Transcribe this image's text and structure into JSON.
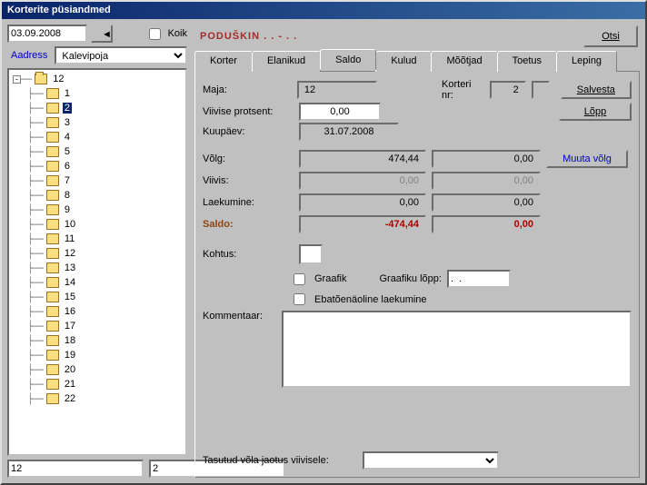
{
  "title": "Korterite püsiandmed",
  "left": {
    "date": "03.09.2008",
    "koik_label": "Koik",
    "addr_label": "Aadress",
    "addr_value": "Kalevipoja",
    "root": "12",
    "selected": "2",
    "children": [
      "1",
      "2",
      "3",
      "4",
      "5",
      "6",
      "7",
      "8",
      "9",
      "10",
      "11",
      "12",
      "13",
      "14",
      "15",
      "16",
      "17",
      "18",
      "19",
      "20",
      "21",
      "22"
    ],
    "bottom1": "12",
    "bottom2": "2"
  },
  "header": {
    "tenant": "PODUŠKIN  . .  -  . .",
    "otsi": "Otsi"
  },
  "tabs": {
    "korter": "Korter",
    "elanikud": "Elanikud",
    "saldo": "Saldo",
    "kulud": "Kulud",
    "mootjad": "Mõõtjad",
    "toetus": "Toetus",
    "leping": "Leping"
  },
  "form": {
    "maja_lbl": "Maja:",
    "maja_val": "12",
    "korterinr_lbl": "Korteri nr:",
    "korterinr_val": "2",
    "viivise_lbl": "Viivise protsent:",
    "viivise_val": "0,00",
    "kuupaev_lbl": "Kuupäev:",
    "kuupaev_val": "31.07.2008",
    "volg_lbl": "Võlg:",
    "volg_a": "474,44",
    "volg_b": "0,00",
    "muuta": "Muuta võlg",
    "viivis_lbl": "Viivis:",
    "viivis_a": "0,00",
    "viivis_b": "0,00",
    "laek_lbl": "Laekumine:",
    "laek_a": "0,00",
    "laek_b": "0,00",
    "saldo_lbl": "Saldo:",
    "saldo_a": "-474,44",
    "saldo_b": "0,00",
    "kohtus_lbl": "Kohtus:",
    "graafik_lbl": "Graafik",
    "graafiku_lopp_lbl": "Graafiku lõpp:",
    "graafiku_lopp_val": ".  .",
    "ebat_lbl": "Ebatõenäoline laekumine",
    "komm_lbl": "Kommentaar:",
    "tasutud_lbl": "Tasutud võla jaotus viivisele:"
  },
  "buttons": {
    "salvesta": "Salvesta",
    "lopp": "Lõpp"
  }
}
